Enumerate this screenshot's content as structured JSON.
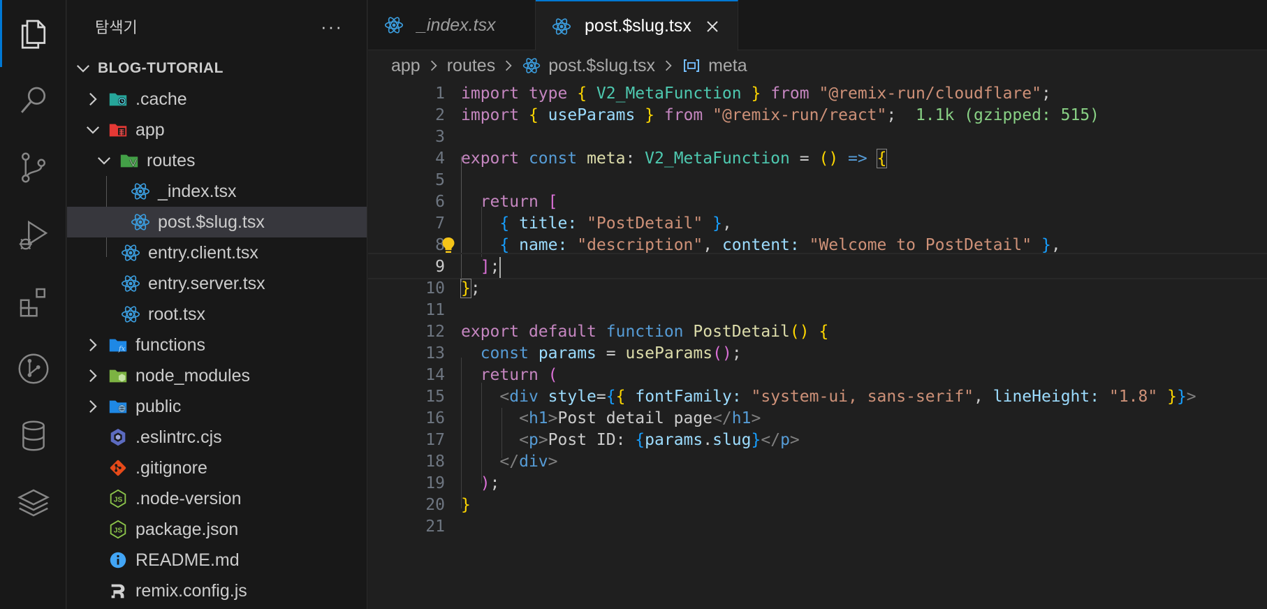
{
  "sidebar": {
    "title": "탐색기",
    "more": "···",
    "root": "BLOG-TUTORIAL",
    "items": [
      {
        "label": ".cache"
      },
      {
        "label": "app"
      },
      {
        "label": "routes"
      },
      {
        "label": "_index.tsx"
      },
      {
        "label": "post.$slug.tsx"
      },
      {
        "label": "entry.client.tsx"
      },
      {
        "label": "entry.server.tsx"
      },
      {
        "label": "root.tsx"
      },
      {
        "label": "functions"
      },
      {
        "label": "node_modules"
      },
      {
        "label": "public"
      },
      {
        "label": ".eslintrc.cjs"
      },
      {
        "label": ".gitignore"
      },
      {
        "label": ".node-version"
      },
      {
        "label": "package.json"
      },
      {
        "label": "README.md"
      },
      {
        "label": "remix.config.js"
      }
    ]
  },
  "tabs": [
    {
      "label": "_index.tsx"
    },
    {
      "label": "post.$slug.tsx"
    }
  ],
  "breadcrumbs": [
    "app",
    "routes",
    "post.$slug.tsx",
    "meta"
  ],
  "editor": {
    "active_line": 9,
    "line_numbers": [
      "1",
      "2",
      "3",
      "4",
      "5",
      "6",
      "7",
      "8",
      "9",
      "10",
      "11",
      "12",
      "13",
      "14",
      "15",
      "16",
      "17",
      "18",
      "19",
      "20",
      "21"
    ],
    "import_size_hint": "1.1k (gzipped: 515)",
    "code": {
      "l1": [
        "import",
        "type",
        "{",
        "V2_MetaFunction",
        "}",
        "from",
        "\"@remix-run/cloudflare\"",
        ";"
      ],
      "l2": [
        "import",
        "{",
        "useParams",
        "}",
        "from",
        "\"@remix-run/react\"",
        ";"
      ],
      "l4": [
        "export",
        "const",
        "meta",
        ":",
        "V2_MetaFunction",
        "=",
        "()",
        "=>",
        "{"
      ],
      "l6": [
        "return",
        "["
      ],
      "l7": [
        "{",
        "title",
        ":",
        "\"PostDetail\"",
        "}",
        ","
      ],
      "l8": [
        "{",
        "name",
        ":",
        "\"description\"",
        ",",
        "content",
        ":",
        "\"Welcome to PostDetail\"",
        "}",
        ","
      ],
      "l9": [
        "]",
        ";"
      ],
      "l10": [
        "}",
        ";"
      ],
      "l12": [
        "export",
        "default",
        "function",
        "PostDetail",
        "()",
        "{"
      ],
      "l13": [
        "const",
        "params",
        "=",
        "useParams",
        "()",
        ";"
      ],
      "l14": [
        "return",
        "("
      ],
      "l15": [
        "<",
        "div",
        "style",
        "=",
        "{",
        "{",
        "fontFamily",
        ":",
        "\"system-ui, sans-serif\"",
        ",",
        "lineHeight",
        ":",
        "\"1.8\"",
        "}",
        "}",
        ">"
      ],
      "l16": [
        "<",
        "h1",
        ">",
        "Post detail page",
        "</",
        "h1",
        ">"
      ],
      "l17": [
        "<",
        "p",
        ">",
        "Post ID: ",
        "{",
        "params",
        ".",
        "slug",
        "}",
        "</",
        "p",
        ">"
      ],
      "l18": [
        "</",
        "div",
        ">"
      ],
      "l19": [
        ")",
        ";"
      ],
      "l20": [
        "}"
      ]
    }
  },
  "colors": {
    "accent": "#0078d4",
    "react": "#3b9dde",
    "keyword": "#c586c0",
    "string": "#ce9178",
    "type": "#4ec9b0",
    "variable": "#9cdcfe",
    "function": "#dcdcaa",
    "size_hint": "#89d185"
  },
  "icons": {
    "activity_bar": [
      "explorer-icon",
      "search-icon",
      "source-control-icon",
      "run-debug-icon",
      "extensions-icon",
      "git-graph-icon",
      "database-icon",
      "layers-icon"
    ]
  }
}
